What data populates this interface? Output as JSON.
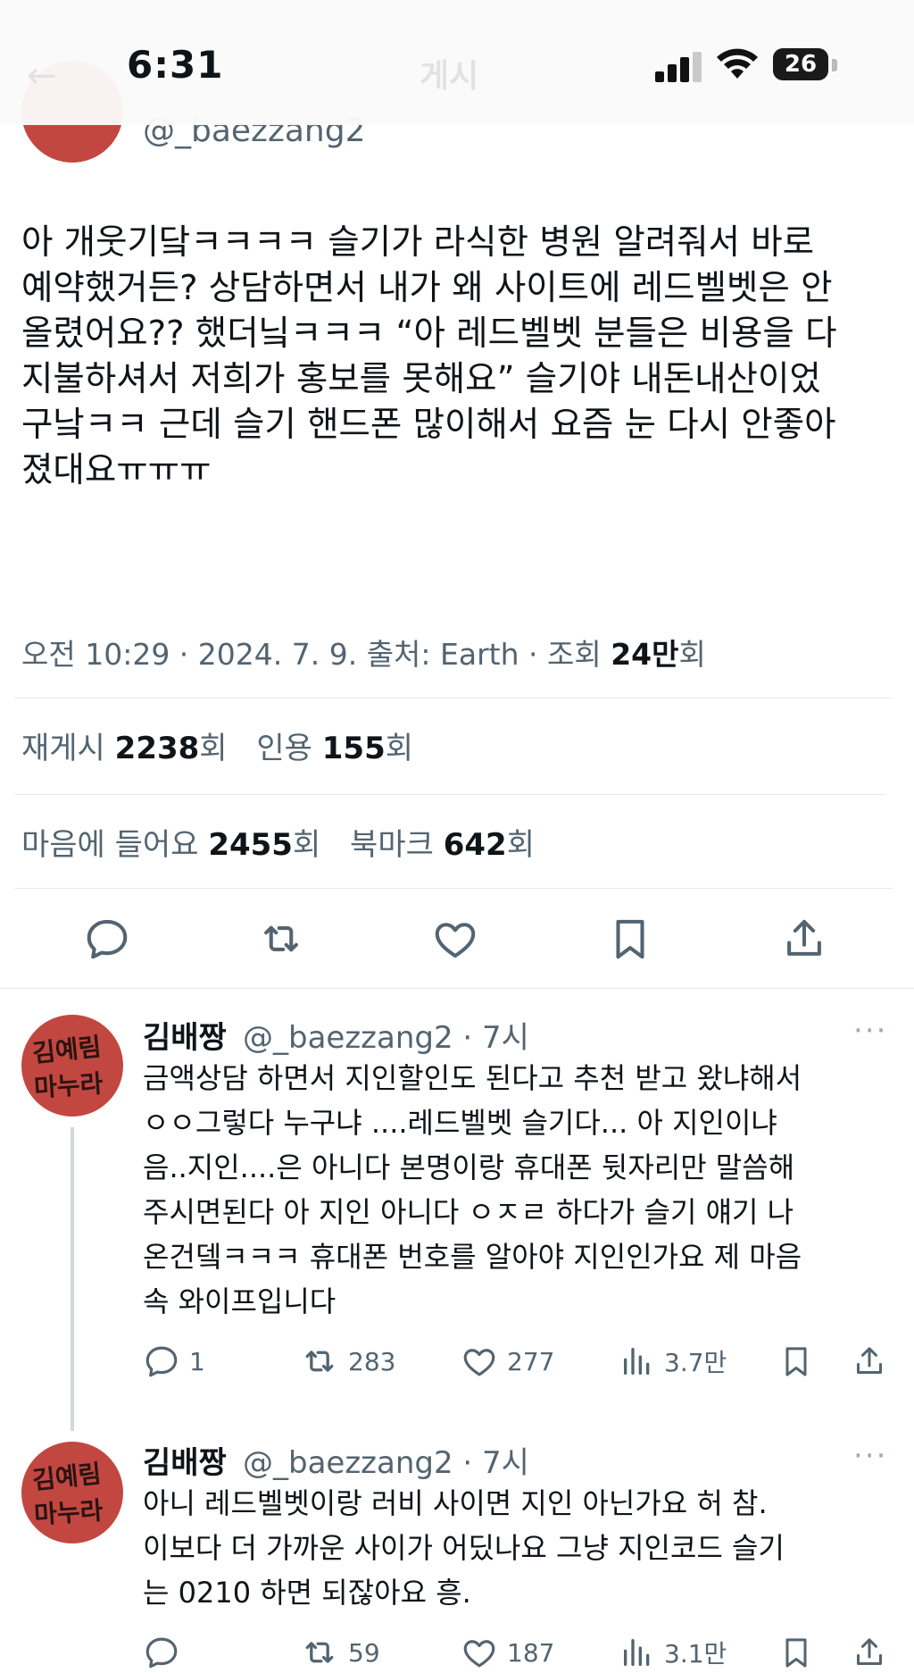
{
  "status_bar": {
    "time": "6:31",
    "battery": "26",
    "title": "게시"
  },
  "tweet": {
    "handle": "@_baezzang2",
    "body": "아 개웃기닼ㅋㅋㅋㅋ 슬기가 라식한 병원 알려줘서 바로\n예약했거든? 상담하면서 내가 왜 사이트에 레드벨벳은 안\n올렸어요?? 했더닠ㅋㅋㅋ “아 레드벨벳 분들은 비용을 다\n지불하셔서 저희가 홍보를 못해요” 슬기야 내돈내산이었\n구낰ㅋㅋ 근데 슬기 핸드폰 많이해서 요즘 눈 다시 안좋아\n졌대요ㅠㅠㅠ",
    "meta_prefix": "오전 10:29 · 2024. 7. 9. 출처: Earth · 조회 ",
    "views": "24만",
    "views_suffix": "회",
    "stats": {
      "retweets_label": "재게시",
      "retweets": "2238",
      "retweets_unit": "회",
      "quotes_label": "인용",
      "quotes": "155",
      "quotes_unit": "회",
      "likes_label": "마음에 들어요",
      "likes": "2455",
      "likes_unit": "회",
      "bookmarks_label": "북마크",
      "bookmarks": "642",
      "bookmarks_unit": "회"
    },
    "actions": [
      "reply-icon",
      "retweet-icon",
      "like-icon",
      "bookmark-icon",
      "share-icon"
    ]
  },
  "replies": [
    {
      "name": "김배짱",
      "handle": "@_baezzang2 · 7시",
      "more": "···",
      "avatar_text": "김예림 마누라",
      "text": "금액상담 하면서 지인할인도 된다고 추천 받고 왔냐해서\nㅇㅇ그렇다 누구냐 ....레드벨벳 슬기다... 아 지인이냐\n음..지인....은 아니다 본명이랑 휴대폰 뒷자리만 말씀해\n주시면된다 아 지인 아니다 ㅇㅈㄹ 하다가 슬기 얘기 나\n온건뎈ㅋㅋㅋ 휴대폰 번호를 알아야 지인인가요 제 마음\n속 와이프입니다",
      "replies": "1",
      "retweets": "283",
      "likes": "277",
      "views": "3.7만"
    },
    {
      "name": "김배짱",
      "handle": "@_baezzang2 · 7시",
      "more": "···",
      "avatar_text": "김예림 마누라",
      "text": "아니 레드벨벳이랑 러비 사이면 지인 아닌가요 허 참.\n이보다 더 가까운 사이가 어딨나요 그냥 지인코드 슬기\n는 0210 하면 되잖아요 흥.",
      "replies": "",
      "retweets": "59",
      "likes": "187",
      "views": "3.1만"
    }
  ],
  "colors": {
    "text": "#0f1419",
    "secondary": "#536471",
    "divider": "#e6e9eb",
    "avatar": "#c24740"
  }
}
